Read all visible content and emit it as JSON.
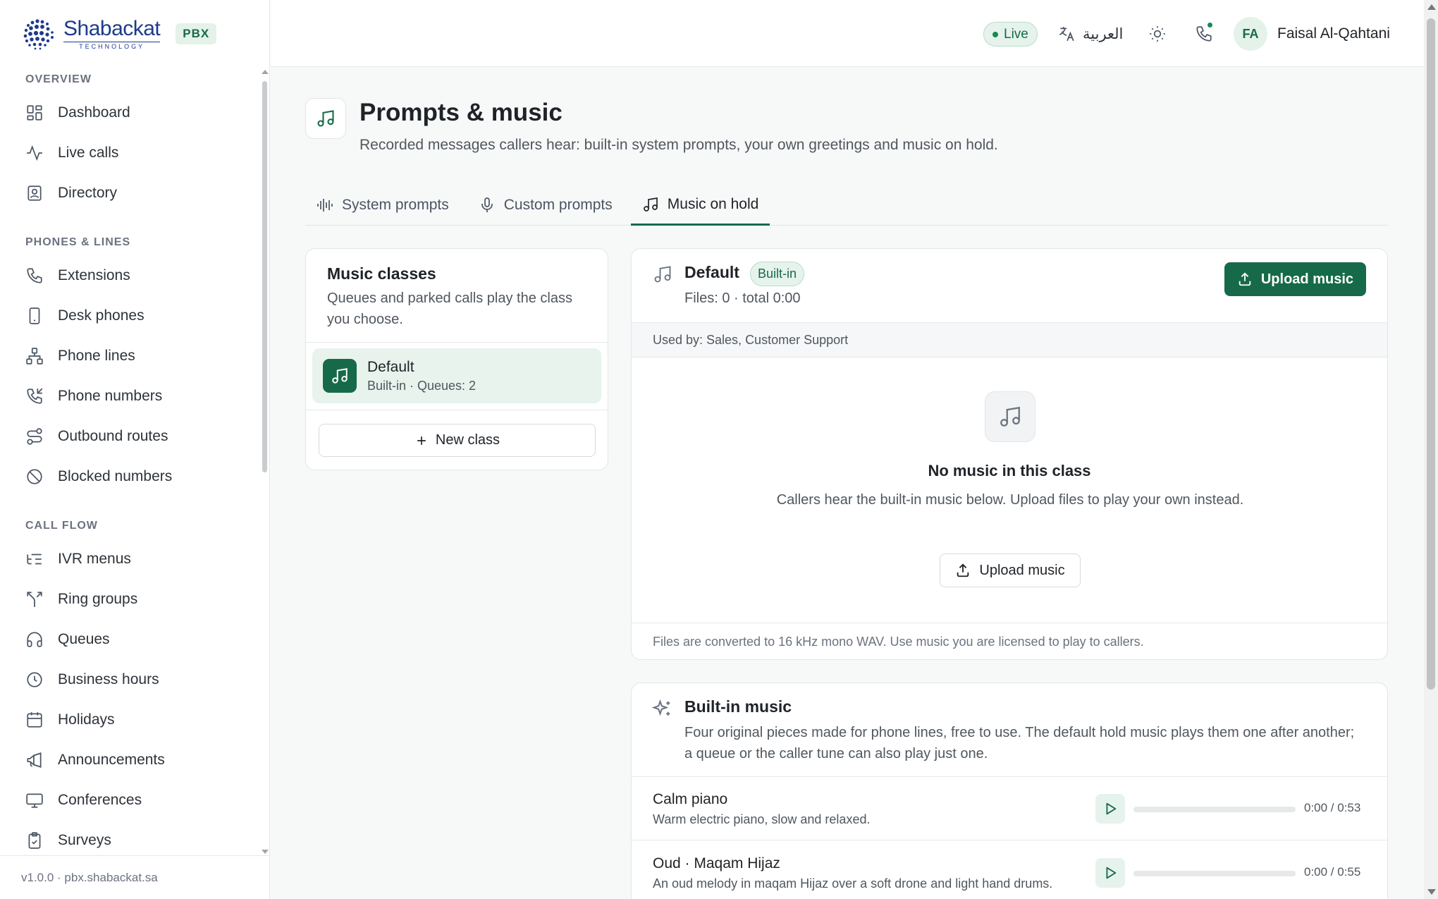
{
  "brand": {
    "name": "Shabackat",
    "tagline": "TECHNOLOGY",
    "badge": "PBX"
  },
  "sidebar": {
    "sections": [
      {
        "title": "OVERVIEW",
        "items": [
          {
            "label": "Dashboard",
            "icon": "dashboard-icon"
          },
          {
            "label": "Live calls",
            "icon": "activity-icon"
          },
          {
            "label": "Directory",
            "icon": "contact-book-icon"
          }
        ]
      },
      {
        "title": "PHONES & LINES",
        "items": [
          {
            "label": "Extensions",
            "icon": "phone-icon"
          },
          {
            "label": "Desk phones",
            "icon": "smartphone-icon"
          },
          {
            "label": "Phone lines",
            "icon": "network-icon"
          },
          {
            "label": "Phone numbers",
            "icon": "phone-incoming-icon"
          },
          {
            "label": "Outbound routes",
            "icon": "route-icon"
          },
          {
            "label": "Blocked numbers",
            "icon": "ban-icon"
          }
        ]
      },
      {
        "title": "CALL FLOW",
        "items": [
          {
            "label": "IVR menus",
            "icon": "list-tree-icon"
          },
          {
            "label": "Ring groups",
            "icon": "split-icon"
          },
          {
            "label": "Queues",
            "icon": "headphones-icon"
          },
          {
            "label": "Business hours",
            "icon": "clock-icon"
          },
          {
            "label": "Holidays",
            "icon": "calendar-icon"
          },
          {
            "label": "Announcements",
            "icon": "megaphone-icon"
          },
          {
            "label": "Conferences",
            "icon": "monitor-icon"
          },
          {
            "label": "Surveys",
            "icon": "clipboard-check-icon"
          }
        ]
      }
    ],
    "footer": "v1.0.0 · pbx.shabackat.sa"
  },
  "topbar": {
    "live_label": "Live",
    "language_label": "العربية",
    "user_initials": "FA",
    "user_name": "Faisal Al-Qahtani"
  },
  "page": {
    "title": "Prompts & music",
    "subtitle": "Recorded messages callers hear: built-in system prompts, your own greetings and music on hold."
  },
  "tabs": [
    {
      "label": "System prompts",
      "icon": "audio-waveform-icon",
      "active": false
    },
    {
      "label": "Custom prompts",
      "icon": "microphone-icon",
      "active": false
    },
    {
      "label": "Music on hold",
      "icon": "music-note-icon",
      "active": true
    }
  ],
  "music_classes": {
    "title": "Music classes",
    "description": "Queues and parked calls play the class you choose.",
    "items": [
      {
        "name": "Default",
        "meta": "Built-in · Queues: 2",
        "selected": true
      }
    ],
    "new_class_label": "New class"
  },
  "selected_class": {
    "name": "Default",
    "badge": "Built-in",
    "files": "Files: 0 · total 0:00",
    "upload_label": "Upload music",
    "used_by": "Used by: Sales, Customer Support",
    "empty_title": "No music in this class",
    "empty_desc": "Callers hear the built-in music below. Upload files to play your own instead.",
    "empty_upload_label": "Upload music",
    "footer_note": "Files are converted to 16 kHz mono WAV. Use music you are licensed to play to callers."
  },
  "builtin_music": {
    "title": "Built-in music",
    "description": "Four original pieces made for phone lines, free to use. The default hold music plays them one after another; a queue or the caller tune can also play just one.",
    "tracks": [
      {
        "name": "Calm piano",
        "desc": "Warm electric piano, slow and relaxed.",
        "time": "0:00 / 0:53",
        "progress": 0
      },
      {
        "name": "Oud · Maqam Hijaz",
        "desc": "An oud melody in maqam Hijaz over a soft drone and light hand drums.",
        "time": "0:00 / 0:55",
        "progress": 0
      }
    ]
  },
  "colors": {
    "accent": "#166a4a",
    "accent_soft": "#e6f3ec",
    "brand_blue": "#1e3a8a"
  }
}
